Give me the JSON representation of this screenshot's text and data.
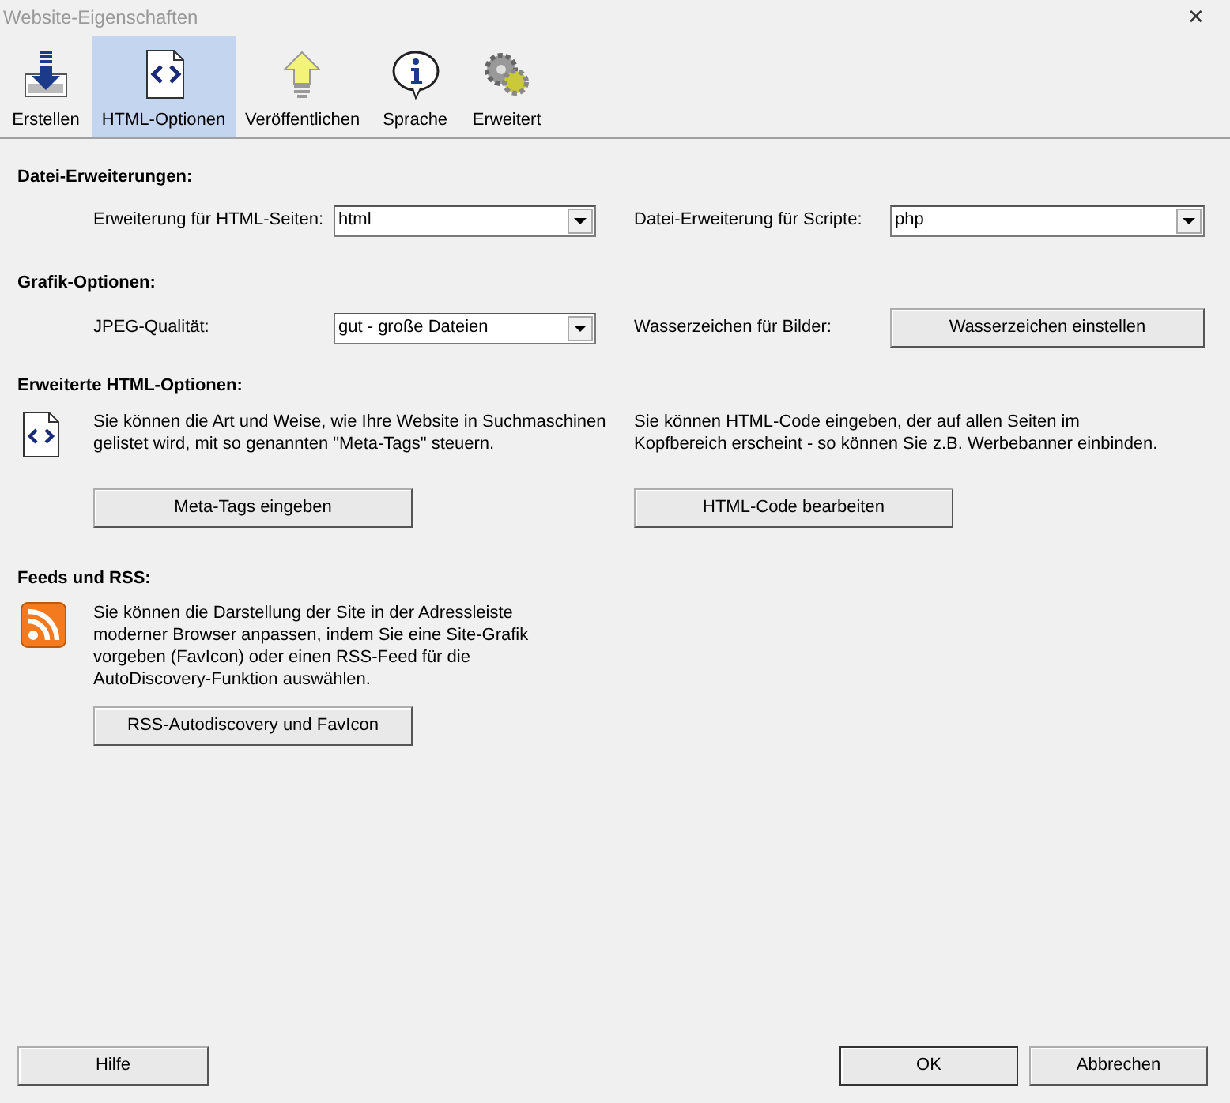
{
  "window": {
    "title": "Website-Eigenschaften",
    "close": "✕"
  },
  "toolbar": [
    {
      "label": "Erstellen",
      "kind": "download",
      "selected": false
    },
    {
      "label": "HTML-Optionen",
      "kind": "code",
      "selected": true
    },
    {
      "label": "Veröffentlichen",
      "kind": "upload",
      "selected": false
    },
    {
      "label": "Sprache",
      "kind": "info",
      "selected": false
    },
    {
      "label": "Erweitert",
      "kind": "gears",
      "selected": false
    }
  ],
  "file_extensions": {
    "heading": "Datei-Erweiterungen:",
    "html_label": "Erweiterung für HTML-Seiten:",
    "html_value": "html",
    "script_label": "Datei-Erweiterung für Scripte:",
    "script_value": "php"
  },
  "graphics": {
    "heading": "Grafik-Optionen:",
    "jpeg_label": "JPEG-Qualität:",
    "jpeg_value": "gut - große Dateien",
    "watermark_label": "Wasserzeichen für Bilder:",
    "watermark_button": "Wasserzeichen einstellen"
  },
  "advanced_html": {
    "heading": "Erweiterte HTML-Optionen:",
    "meta_text": "Sie können die Art und Weise, wie Ihre Website in Suchmaschinen gelistet wird, mit so genannten \"Meta-Tags\" steuern.",
    "meta_button": "Meta-Tags eingeben",
    "code_text": "Sie können HTML-Code eingeben, der auf allen Seiten im Kopfbereich erscheint - so können Sie z.B. Werbebanner einbinden.",
    "code_button": "HTML-Code bearbeiten"
  },
  "feeds": {
    "heading": "Feeds und RSS:",
    "text": "Sie können die Darstellung der Site in der Adressleiste moderner Browser anpassen, indem Sie eine Site-Grafik vorgeben (FavIcon) oder einen RSS-Feed für die AutoDiscovery-Funktion auswählen.",
    "button": "RSS-Autodiscovery und FavIcon"
  },
  "buttons": {
    "help": "Hilfe",
    "ok": "OK",
    "cancel": "Abbrechen"
  }
}
